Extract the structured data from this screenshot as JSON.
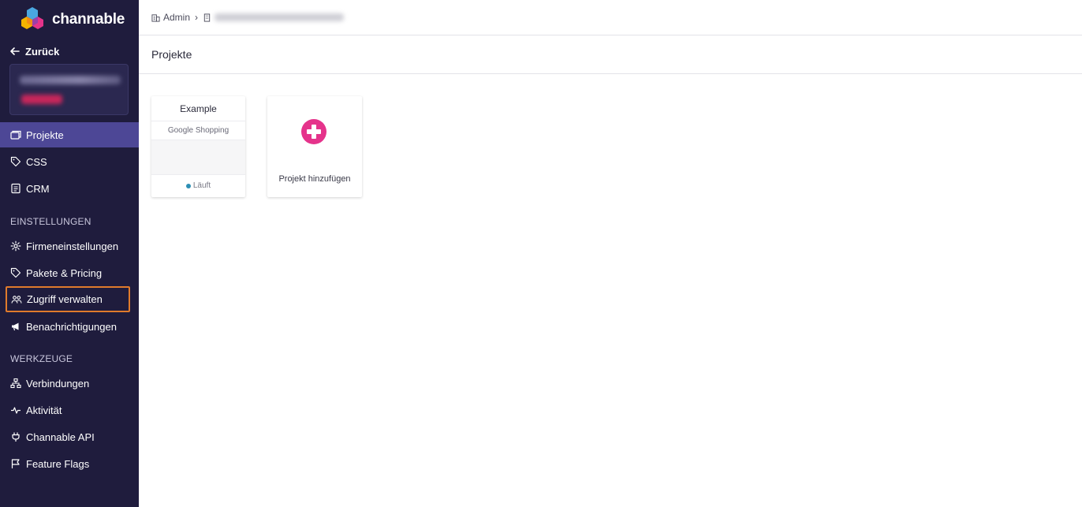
{
  "brand": {
    "name": "channable",
    "colors": {
      "sidebar_bg": "#1f1c3d",
      "active_item": "#4d4796",
      "accent_pink": "#e5338b",
      "highlight_orange": "#e07b2c",
      "status_blue": "#2d8fb4"
    }
  },
  "sidebar": {
    "back_label": "Zurück",
    "main_items": [
      {
        "label": "Projekte",
        "icon": "folders-icon",
        "active": true
      },
      {
        "label": "CSS",
        "icon": "tag-icon"
      },
      {
        "label": "CRM",
        "icon": "document-icon"
      }
    ],
    "settings_heading": "EINSTELLUNGEN",
    "settings_items": [
      {
        "label": "Firmeneinstellungen",
        "icon": "gear-icon"
      },
      {
        "label": "Pakete & Pricing",
        "icon": "tag-icon"
      },
      {
        "label": "Zugriff verwalten",
        "icon": "users-icon",
        "highlighted": true
      },
      {
        "label": "Benachrichtigungen",
        "icon": "megaphone-icon"
      }
    ],
    "tools_heading": "WERKZEUGE",
    "tools_items": [
      {
        "label": "Verbindungen",
        "icon": "network-icon"
      },
      {
        "label": "Aktivität",
        "icon": "pulse-icon"
      },
      {
        "label": "Channable API",
        "icon": "plug-icon"
      },
      {
        "label": "Feature Flags",
        "icon": "flag-icon"
      }
    ]
  },
  "breadcrumb": {
    "admin_label": "Admin"
  },
  "page": {
    "title": "Projekte"
  },
  "projects": [
    {
      "name": "Example",
      "channel": "Google Shopping",
      "status": "Läuft"
    }
  ],
  "add_project_label": "Projekt hinzufügen"
}
